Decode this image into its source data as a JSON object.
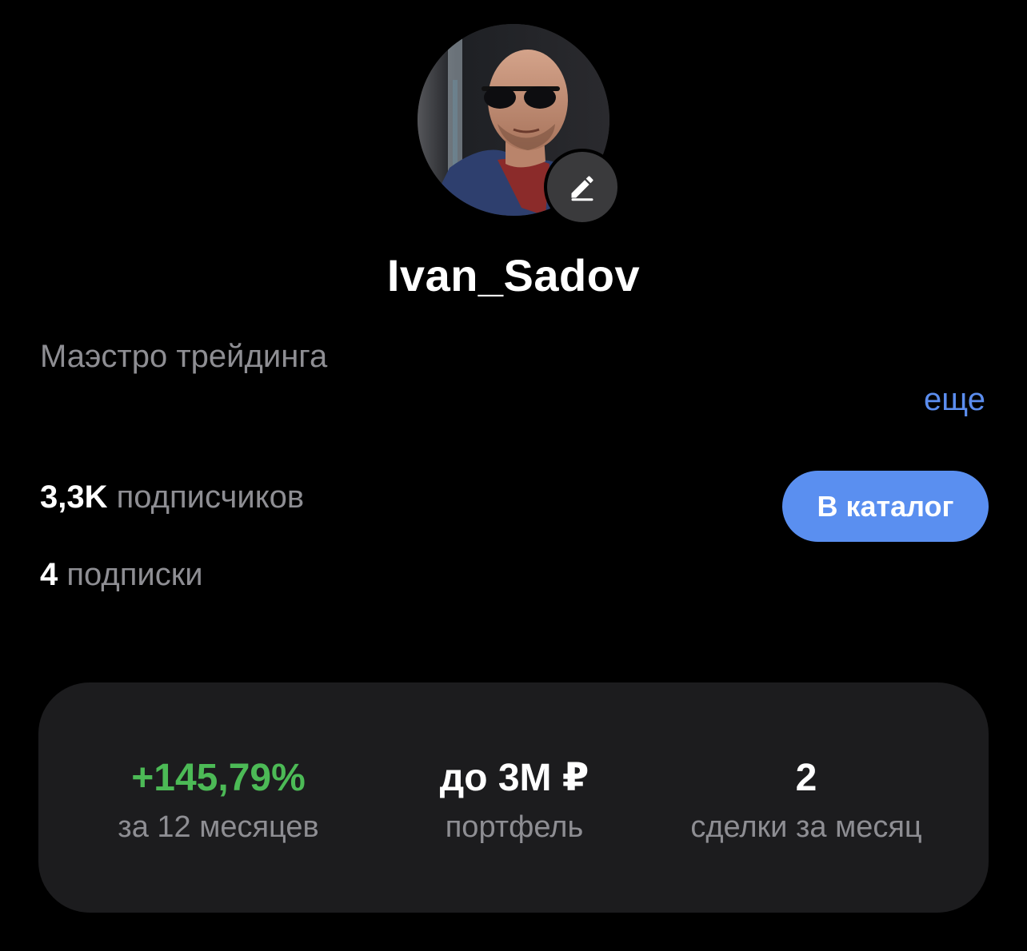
{
  "profile": {
    "username": "Ivan_Sadov",
    "bio": "Маэстро трейдинга",
    "more_label": "еще",
    "avatar_icon": "profile-photo",
    "edit_icon": "pencil-icon"
  },
  "counters": {
    "followers_value": "3,3K",
    "followers_label": "подписчиков",
    "subscriptions_value": "4",
    "subscriptions_label": "подписки"
  },
  "catalog_button": {
    "label": "В каталог"
  },
  "stats": {
    "return_value": "+145,79%",
    "return_caption": "за 12 месяцев",
    "portfolio_value": "до 3М ₽",
    "portfolio_caption": "портфель",
    "trades_value": "2",
    "trades_caption": "сделки за месяц"
  },
  "colors": {
    "background": "#000000",
    "card": "#1c1c1e",
    "accent_blue": "#5a8ff0",
    "positive_green": "#4cba56",
    "muted_text": "#8e8e93"
  }
}
